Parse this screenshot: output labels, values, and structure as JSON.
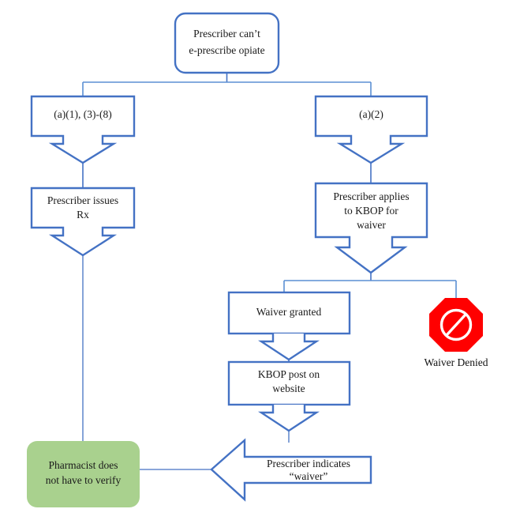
{
  "diagram": {
    "title_node": {
      "label_line1": "Prescriber can’t",
      "label_line2": "e-prescribe opiate"
    },
    "branches": {
      "left_label": "(a)(1), (3)-(8)",
      "right_label": "(a)(2)"
    },
    "nodes": {
      "prescriber_issues_rx_line1": "Prescriber issues",
      "prescriber_issues_rx_line2": "Rx",
      "applies_kbop_line1": "Prescriber applies",
      "applies_kbop_line2": "to KBOP for",
      "applies_kbop_line3": "waiver",
      "waiver_granted": "Waiver granted",
      "kbop_post_line1": "KBOP post on",
      "kbop_post_line2": "website",
      "prescriber_indicates_line1": "Prescriber indicates",
      "prescriber_indicates_line2": "“waiver”",
      "pharmacist_line1": "Pharmacist does",
      "pharmacist_line2": "not have to verify",
      "waiver_denied_caption": "Waiver Denied"
    },
    "icons": {
      "stop_sign": "prohibition-octagon-icon"
    },
    "colors": {
      "outline_blue": "#4472C4",
      "connector_blue": "#5B8FD4",
      "green_fill": "#A9D18E",
      "stop_red": "#FF0000",
      "text": "#1a1a1a",
      "box_fill": "#FFFFFF"
    }
  }
}
